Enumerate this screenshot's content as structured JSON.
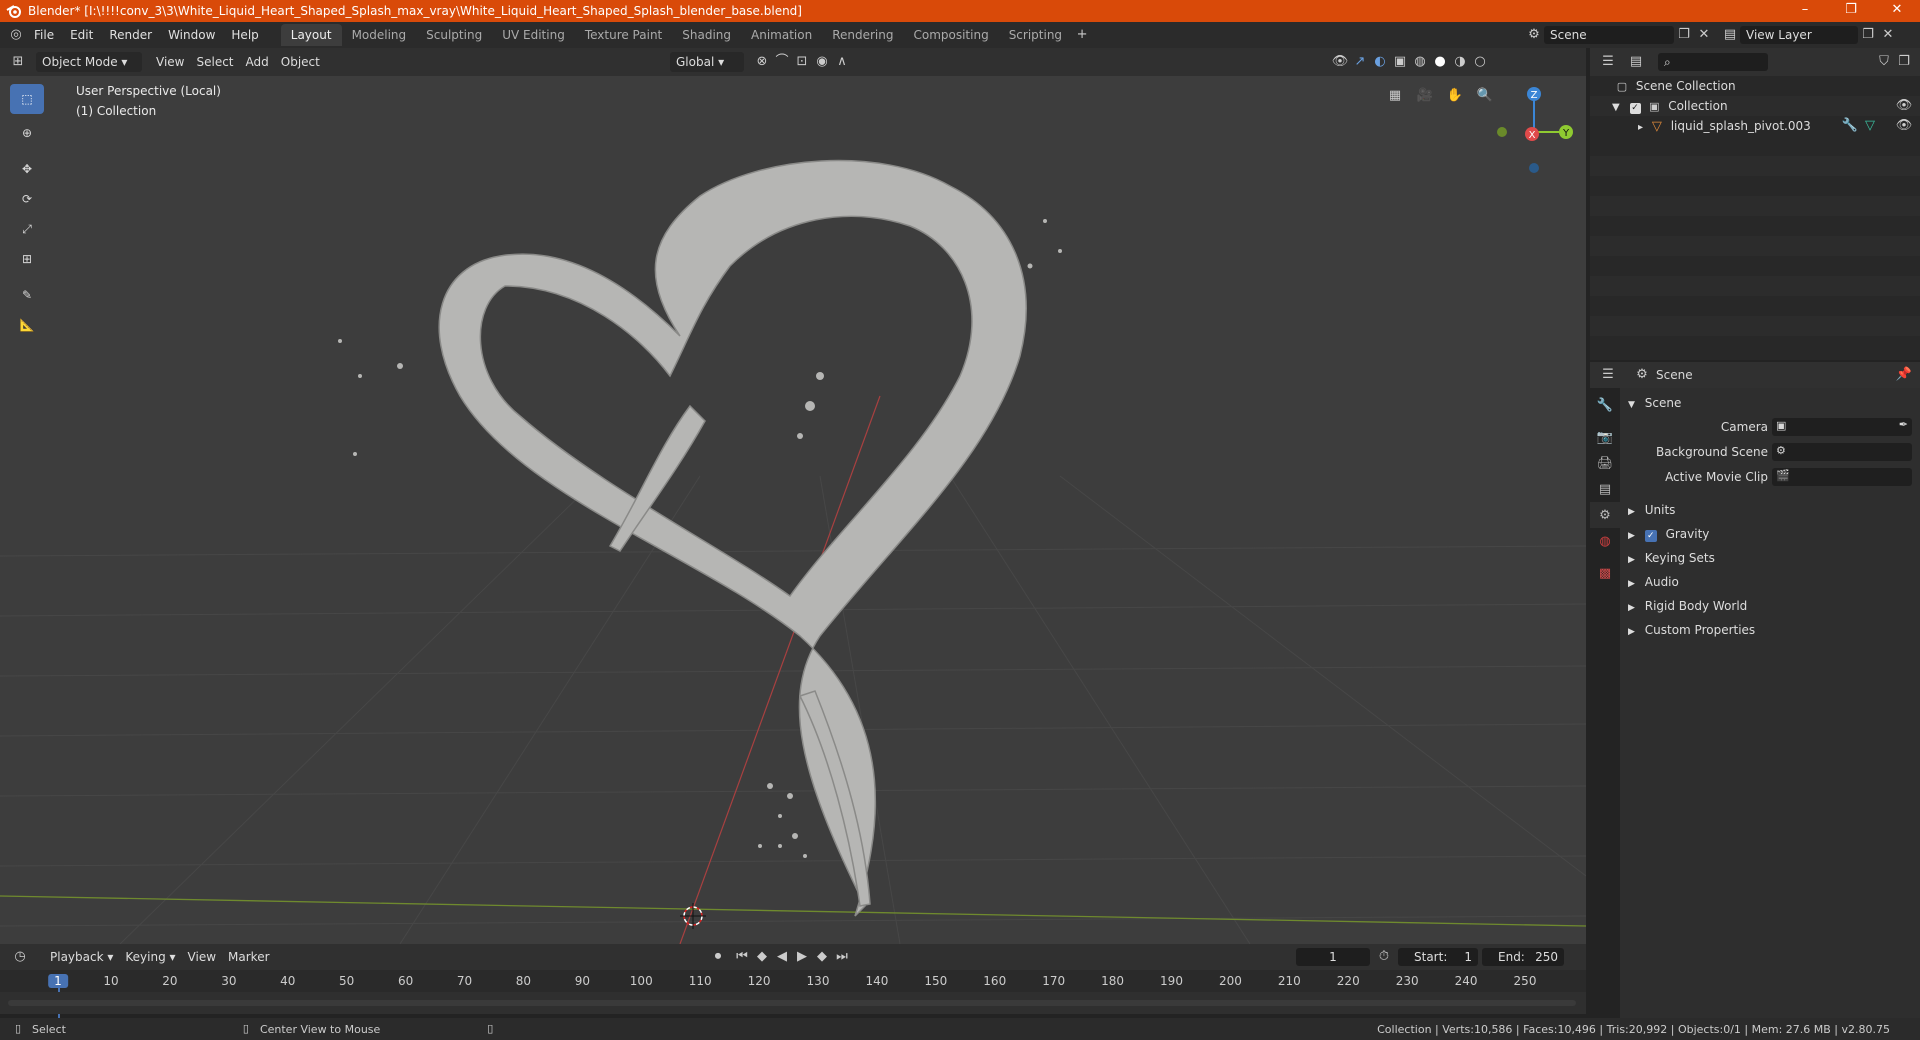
{
  "window": {
    "title": "Blender* [I:\\!!!!conv_3\\3\\White_Liquid_Heart_Shaped_Splash_max_vray\\White_Liquid_Heart_Shaped_Splash_blender_base.blend]",
    "controls": [
      "–",
      "❐",
      "✕"
    ]
  },
  "menu": [
    "File",
    "Edit",
    "Render",
    "Window",
    "Help"
  ],
  "workspaces": [
    "Layout",
    "Modeling",
    "Sculpting",
    "UV Editing",
    "Texture Paint",
    "Shading",
    "Animation",
    "Rendering",
    "Compositing",
    "Scripting"
  ],
  "active_workspace": "Layout",
  "scene_selector": {
    "value": "Scene"
  },
  "view_layer_selector": {
    "value": "View Layer"
  },
  "viewport_header": {
    "mode": "Object Mode",
    "menus": [
      "View",
      "Select",
      "Add",
      "Object"
    ],
    "orientation": "Global"
  },
  "viewport": {
    "perspective": "User Perspective (Local)",
    "collection": "(1) Collection",
    "gizmo": {
      "z": "Z",
      "y": "Y",
      "x": "X"
    }
  },
  "outliner": {
    "root": "Scene Collection",
    "collection": "Collection",
    "object": "liquid_splash_pivot.003"
  },
  "properties": {
    "header": "Scene",
    "section": "Scene",
    "fields": {
      "camera": "Camera",
      "background_scene": "Background Scene",
      "active_movie_clip": "Active Movie Clip"
    },
    "panels": [
      "Units",
      "Gravity",
      "Keying Sets",
      "Audio",
      "Rigid Body World",
      "Custom Properties"
    ],
    "gravity_checked": true
  },
  "timeline": {
    "menus": [
      "Playback",
      "Keying",
      "View",
      "Marker"
    ],
    "current_frame": "1",
    "start_label": "Start:",
    "start": "1",
    "end_label": "End:",
    "end": "250",
    "ticks": [
      "1",
      "10",
      "20",
      "30",
      "40",
      "50",
      "60",
      "70",
      "80",
      "90",
      "100",
      "110",
      "120",
      "130",
      "140",
      "150",
      "160",
      "170",
      "180",
      "190",
      "200",
      "210",
      "220",
      "230",
      "240",
      "250"
    ]
  },
  "statusbar": {
    "left": "Select",
    "middle": "Center View to Mouse",
    "right": "Collection | Verts:10,586 | Faces:10,496 | Tris:20,992 | Objects:0/1 | Mem: 27.6 MB | v2.80.75"
  },
  "colors": {
    "titlebar": "#d94a09",
    "accent": "#4772b3",
    "x_axis": "#e04a4a",
    "y_axis": "#8fca31",
    "z_axis": "#3b86d6"
  }
}
